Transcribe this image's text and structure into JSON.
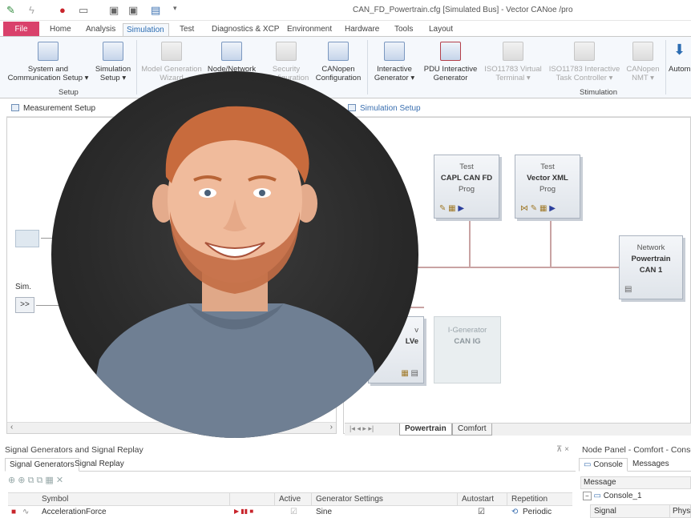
{
  "window": {
    "title": "CAN_FD_Powertrain.cfg [Simulated Bus] - Vector CANoe /pro"
  },
  "menu": {
    "tabs": [
      "File",
      "Home",
      "Analysis",
      "Simulation",
      "Test",
      "Diagnostics & XCP",
      "Environment",
      "Hardware",
      "Tools",
      "Layout"
    ],
    "active": "Simulation"
  },
  "ribbon": {
    "setup": {
      "group_label": "Setup",
      "system_label": "System and\nCommunication Setup ▾",
      "simulation_label": "Simulation\nSetup ▾"
    },
    "middle": {
      "model_gen_label": "Model Generation\nWizard",
      "node_network_label": "Node/Network",
      "security_label": "Security\nConfiguration",
      "canopen_label": "CANopen\nConfiguration"
    },
    "stimulation": {
      "group_label": "Stimulation",
      "interactive_gen_label": "Interactive\nGenerator ▾",
      "pdu_gen_label": "PDU Interactive\nGenerator",
      "iso_terminal_label": "ISO11783 Virtual\nTerminal ▾",
      "iso_task_label": "ISO11783 Interactive\nTask Controller ▾",
      "canopen_nmt_label": "CANopen\nNMT ▾",
      "auto_label": "Autom"
    }
  },
  "panels": {
    "measurement_setup": "Measurement Setup",
    "simulation_setup": "Simulation Setup",
    "sim_label": "Sim.",
    "sim_button": ">>"
  },
  "nodes": {
    "capl": {
      "line1": "Test",
      "line2": "CAPL CAN FD",
      "line3": "Prog"
    },
    "vector_xml": {
      "line1": "Test",
      "line2": "Vector XML",
      "line3": "Prog"
    },
    "network": {
      "line1": "Network",
      "line2": "Powertrain",
      "line3": "CAN 1"
    },
    "igen": {
      "line1": "I-Generator",
      "line2": "CAN IG"
    },
    "partial": {
      "line1": "v",
      "line2": "LVe"
    }
  },
  "bus_tabs": [
    "Powertrain",
    "Comfort"
  ],
  "signal_generators": {
    "title": "Signal Generators and Signal Replay",
    "tabs": [
      "Signal Generators",
      "Signal Replay"
    ],
    "columns": [
      "Symbol",
      "Active",
      "Generator Settings",
      "Autostart",
      "Repetition"
    ],
    "rows": [
      {
        "symbol": "AccelerationForce",
        "active": "☑",
        "generator": "Sine",
        "autostart": "☑",
        "repetition": "Periodic"
      }
    ]
  },
  "node_panel": {
    "title": "Node Panel - Comfort - Conso",
    "tabs": [
      "Console",
      "Messages"
    ],
    "message_header": "Message",
    "console_item": "Console_1",
    "sub_columns": [
      "Signal",
      "Physic"
    ]
  },
  "colors": {
    "file_tab": "#d9416b",
    "ribbon_bg": "#f5f8fc",
    "active_tab_text": "#2c6db2",
    "bus_line": "#c9a3a3",
    "hair": "#c86b3d",
    "shirt": "#6f7f93"
  }
}
